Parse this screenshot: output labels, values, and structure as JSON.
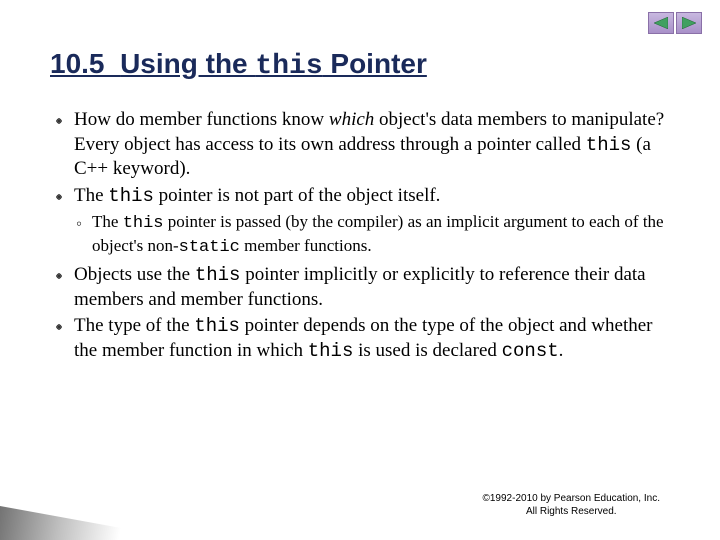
{
  "nav": {
    "prev": "previous-slide",
    "next": "next-slide"
  },
  "title": {
    "section_number": "10.5",
    "pre": "Using the ",
    "code": "this",
    "post": " Pointer"
  },
  "bullets": [
    {
      "segments": [
        {
          "t": "How do member functions know "
        },
        {
          "t": "which",
          "italic": true
        },
        {
          "t": " object's data members to manipulate? Every object has access to its own address through a pointer called "
        },
        {
          "t": "this",
          "code": true
        },
        {
          "t": " (a C++ keyword)."
        }
      ]
    },
    {
      "segments": [
        {
          "t": "The "
        },
        {
          "t": "this",
          "code": true
        },
        {
          "t": " pointer is not part of the object itself."
        }
      ],
      "sub": [
        {
          "segments": [
            {
              "t": "The "
            },
            {
              "t": "this",
              "code": true
            },
            {
              "t": " pointer is passed (by the compiler) as an implicit argument to each of the object's non-"
            },
            {
              "t": "static",
              "code": true
            },
            {
              "t": " member functions."
            }
          ]
        }
      ]
    },
    {
      "segments": [
        {
          "t": "Objects use the "
        },
        {
          "t": "this",
          "code": true
        },
        {
          "t": " pointer implicitly or explicitly to reference their data members and member functions."
        }
      ]
    },
    {
      "segments": [
        {
          "t": "The type of the "
        },
        {
          "t": "this",
          "code": true
        },
        {
          "t": " pointer depends on the type of the object and whether the member function in which "
        },
        {
          "t": "this",
          "code": true
        },
        {
          "t": " is used is declared "
        },
        {
          "t": "const",
          "code": true
        },
        {
          "t": "."
        }
      ]
    }
  ],
  "copyright": {
    "line1": "©1992-2010 by Pearson Education, Inc.",
    "line2": "All Rights Reserved."
  }
}
